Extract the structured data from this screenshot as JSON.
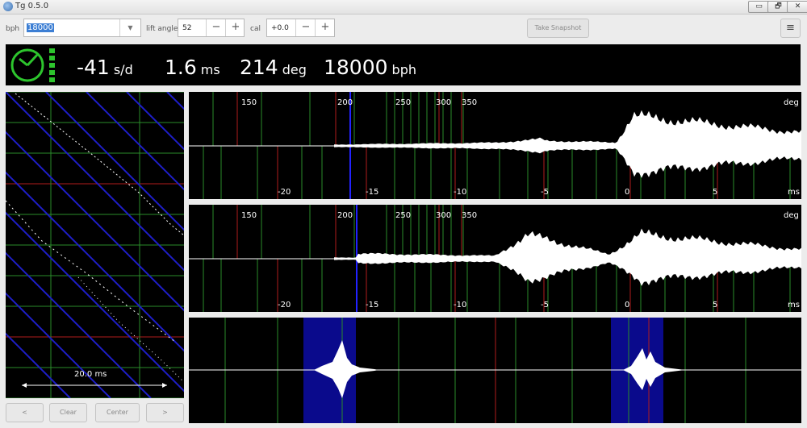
{
  "window": {
    "title": "Tg 0.5.0",
    "controls": [
      "▭",
      "🗗",
      "✕"
    ]
  },
  "toolbar": {
    "bph_label": "bph",
    "bph_value": "18000",
    "lift_label": "lift angle",
    "lift_value": "52",
    "cal_label": "cal",
    "cal_value": "+0.0",
    "minus": "−",
    "plus": "+",
    "dropdown": "▼",
    "snapshot_label": "Take Snapshot",
    "menu_icon": "≡"
  },
  "status": {
    "rate": "-41",
    "rate_unit": "s/d",
    "beat_error": "1.6",
    "beat_error_unit": "ms",
    "amplitude": "214",
    "amplitude_unit": "deg",
    "bph": "18000",
    "bph_unit": "bph"
  },
  "paperstrip": {
    "scale_label": "20.0 ms",
    "buttons": {
      "left": "<",
      "clear": "Clear",
      "center": "Center",
      "right": ">"
    }
  },
  "waveforms": {
    "deg_ticks": [
      "150",
      "200",
      "250",
      "300",
      "350"
    ],
    "deg_unit": "deg",
    "ms_ticks": [
      "-20",
      "-15",
      "-10",
      "-5",
      "0",
      "5"
    ],
    "ms_unit": "ms"
  },
  "colors": {
    "grid_green": "#2a8c2a",
    "grid_red": "#b01c1c",
    "highlight_blue": "#0a0a8c",
    "diag_blue": "#1e1ec8",
    "status_green": "#2dc52d"
  }
}
